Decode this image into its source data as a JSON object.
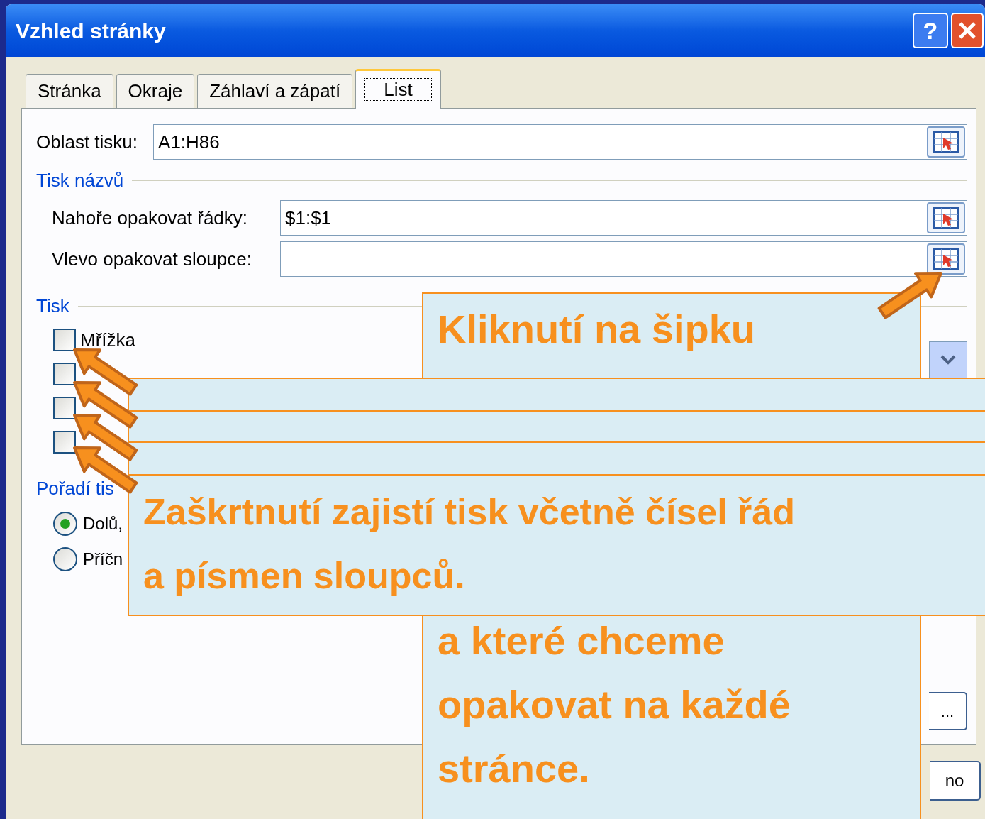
{
  "window": {
    "title": "Vzhled stránky",
    "help": "?"
  },
  "tabs": [
    {
      "label": "Stránka",
      "selected": false
    },
    {
      "label": "Okraje",
      "selected": false
    },
    {
      "label": "Záhlaví a zápatí",
      "selected": false
    },
    {
      "label": "List",
      "selected": true
    }
  ],
  "print_area": {
    "label": "Oblast tisku:",
    "value": "A1:H86"
  },
  "print_titles": {
    "heading": "Tisk názvů",
    "fields": [
      {
        "label": "Nahoře opakovat řádky:",
        "value": "$1:$1"
      },
      {
        "label": "Vlevo opakovat sloupce:"
      }
    ]
  },
  "print": {
    "heading": "Tisk",
    "options": [
      {
        "label": "Mřížka",
        "checked": false
      },
      {
        "checked": false
      },
      {
        "checked": false
      },
      {
        "checked": false
      }
    ]
  },
  "order": {
    "heading": "Pořadí tis",
    "options": [
      {
        "label": "Dolů,",
        "selected": true
      },
      {
        "label": "Příčn",
        "selected": false
      }
    ]
  },
  "buttons": [
    {
      "label": "..."
    },
    {
      "label": "no"
    }
  ],
  "callouts": [
    {
      "kind": "tall",
      "top": "Kliknutí na šipku",
      "lines": [
        "a které chceme",
        "opakovat na každé",
        "stránce."
      ]
    },
    {
      "kind": "strip"
    },
    {
      "kind": "strip"
    },
    {
      "kind": "strip"
    },
    {
      "kind": "box",
      "lines": [
        "Zaškrtnutí zajistí tisk včetně čísel řád",
        "a písmen sloupců."
      ]
    }
  ]
}
